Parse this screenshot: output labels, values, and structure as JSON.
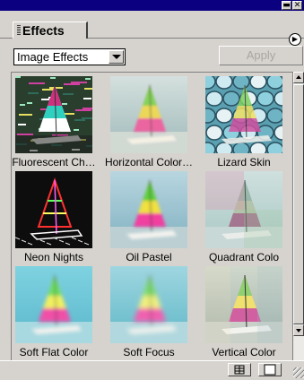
{
  "window": {
    "minimize_glyph": "▬",
    "close_glyph": "✕",
    "title_color": "#0a0080"
  },
  "palette": {
    "tab_label": "Effects",
    "menu_icon": "menu-arrow-icon",
    "menu_glyph": "▶"
  },
  "toolbar": {
    "category": "Image Effects",
    "apply_label": "Apply"
  },
  "effects": [
    {
      "label": "Fluorescent Ch…",
      "style": "fluorescent"
    },
    {
      "label": "Horizontal Color…",
      "style": "horizontal"
    },
    {
      "label": "Lizard Skin",
      "style": "lizard"
    },
    {
      "label": "Neon Nights",
      "style": "neon"
    },
    {
      "label": "Oil Pastel",
      "style": "oil"
    },
    {
      "label": "Quadrant Colo",
      "style": "quadrant"
    },
    {
      "label": "Soft Flat Color",
      "style": "softflat"
    },
    {
      "label": "Soft Focus",
      "style": "softfocus"
    },
    {
      "label": "Vertical Color",
      "style": "vertical"
    }
  ],
  "bottom": {
    "grid_icon": "grid-view-icon",
    "list_icon": "new-item-icon"
  }
}
